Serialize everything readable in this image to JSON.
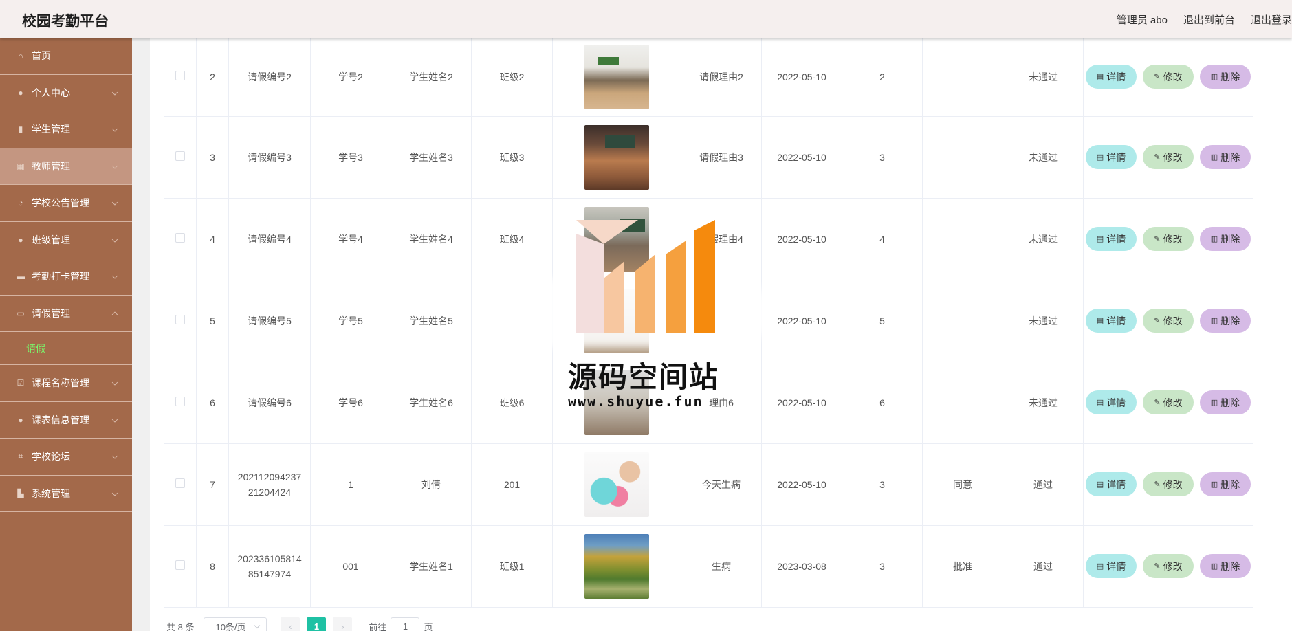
{
  "header": {
    "title": "校园考勤平台",
    "admin": "管理员 abo",
    "back_front": "退出到前台",
    "logout": "退出登录"
  },
  "sidebar": {
    "items": [
      {
        "label": "首页",
        "icon": "home-icon"
      },
      {
        "label": "个人中心",
        "icon": "user-icon"
      },
      {
        "label": "学生管理",
        "icon": "clipboard-icon"
      },
      {
        "label": "教师管理",
        "icon": "grid-icon"
      },
      {
        "label": "学校公告管理",
        "icon": "compass-icon"
      },
      {
        "label": "班级管理",
        "icon": "location-icon"
      },
      {
        "label": "考勤打卡管理",
        "icon": "ticket-icon"
      },
      {
        "label": "请假管理",
        "icon": "chat-icon"
      },
      {
        "label": "课程名称管理",
        "icon": "checkbox-icon"
      },
      {
        "label": "课表信息管理",
        "icon": "user-icon"
      },
      {
        "label": "学校论坛",
        "icon": "crop-icon"
      },
      {
        "label": "系统管理",
        "icon": "cart-icon"
      }
    ],
    "submenu": {
      "label": "请假"
    }
  },
  "table": {
    "rows": [
      {
        "index": "2",
        "leave_no": "请假编号2",
        "student_no": "学号2",
        "student_name": "学生姓名2",
        "class": "班级2",
        "reason": "请假理由2",
        "date": "2022-05-10",
        "days": "2",
        "reply": "",
        "status": "未通过"
      },
      {
        "index": "3",
        "leave_no": "请假编号3",
        "student_no": "学号3",
        "student_name": "学生姓名3",
        "class": "班级3",
        "reason": "请假理由3",
        "date": "2022-05-10",
        "days": "3",
        "reply": "",
        "status": "未通过"
      },
      {
        "index": "4",
        "leave_no": "请假编号4",
        "student_no": "学号4",
        "student_name": "学生姓名4",
        "class": "班级4",
        "reason": "请假理由4",
        "date": "2022-05-10",
        "days": "4",
        "reply": "",
        "status": "未通过"
      },
      {
        "index": "5",
        "leave_no": "请假编号5",
        "student_no": "学号5",
        "student_name": "学生姓名5",
        "class": "",
        "reason": "",
        "date": "2022-05-10",
        "days": "5",
        "reply": "",
        "status": "未通过"
      },
      {
        "index": "6",
        "leave_no": "请假编号6",
        "student_no": "学号6",
        "student_name": "学生姓名6",
        "class": "班级6",
        "reason": "理由6",
        "date": "2022-05-10",
        "days": "6",
        "reply": "",
        "status": "未通过"
      },
      {
        "index": "7",
        "leave_no": "202112094237 21204424",
        "student_no": "1",
        "student_name": "刘倩",
        "class": "201",
        "reason": "今天生病",
        "date": "2022-05-10",
        "days": "3",
        "reply": "同意",
        "status": "通过"
      },
      {
        "index": "8",
        "leave_no": "202336105814 85147974",
        "student_no": "001",
        "student_name": "学生姓名1",
        "class": "班级1",
        "reason": "生病",
        "date": "2023-03-08",
        "days": "3",
        "reply": "批准",
        "status": "通过"
      }
    ],
    "actions": {
      "detail": "详情",
      "edit": "修改",
      "delete": "删除"
    }
  },
  "pagination": {
    "total": "共 8 条",
    "page_size": "10条/页",
    "current_page": "1",
    "goto_label": "前往",
    "goto_value": "1",
    "page_unit": "页"
  },
  "watermark": {
    "text": "源码空间站",
    "url": "www.shuyue.fun"
  },
  "colors": {
    "sidebar_bg": "#a3694a",
    "sidebar_active": "#c49681",
    "submenu_text": "#7cf36a",
    "header_bg": "#f5efee",
    "pager_active": "#1fc1a4",
    "btn_detail": "#aeeaea",
    "btn_edit": "#c9e6c7",
    "btn_delete": "#d6bbe6"
  }
}
